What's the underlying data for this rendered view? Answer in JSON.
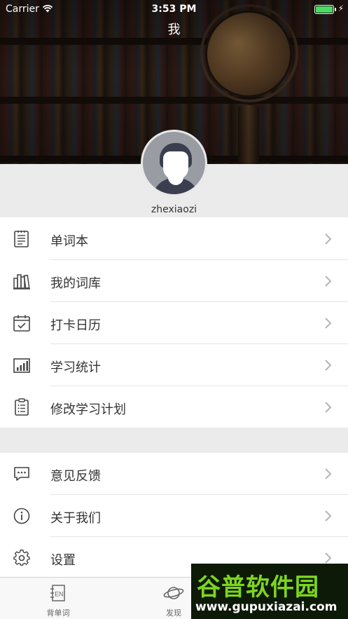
{
  "status_bar": {
    "carrier": "Carrier",
    "time": "3:53 PM"
  },
  "nav": {
    "title": "我"
  },
  "profile": {
    "username": "zhexiaozi"
  },
  "menu_group_1": [
    {
      "label": "单词本",
      "icon": "notebook-icon"
    },
    {
      "label": "我的词库",
      "icon": "books-icon"
    },
    {
      "label": "打卡日历",
      "icon": "calendar-check-icon"
    },
    {
      "label": "学习统计",
      "icon": "bar-chart-icon"
    },
    {
      "label": "修改学习计划",
      "icon": "clipboard-list-icon"
    }
  ],
  "menu_group_2": [
    {
      "label": "意见反馈",
      "icon": "chat-bubble-icon"
    },
    {
      "label": "关于我们",
      "icon": "info-icon"
    },
    {
      "label": "设置",
      "icon": "gear-icon"
    }
  ],
  "tabbar": [
    {
      "label": "背单词",
      "icon": "en-book-icon"
    },
    {
      "label": "发现",
      "icon": "planet-icon"
    }
  ],
  "watermark": {
    "title": "谷普软件园",
    "url": "www.gupuxiazai.com"
  },
  "colors": {
    "battery": "#4cd964",
    "watermark_green": "#7dd51f",
    "separator": "#e5e5e5",
    "band": "#ebebeb"
  }
}
